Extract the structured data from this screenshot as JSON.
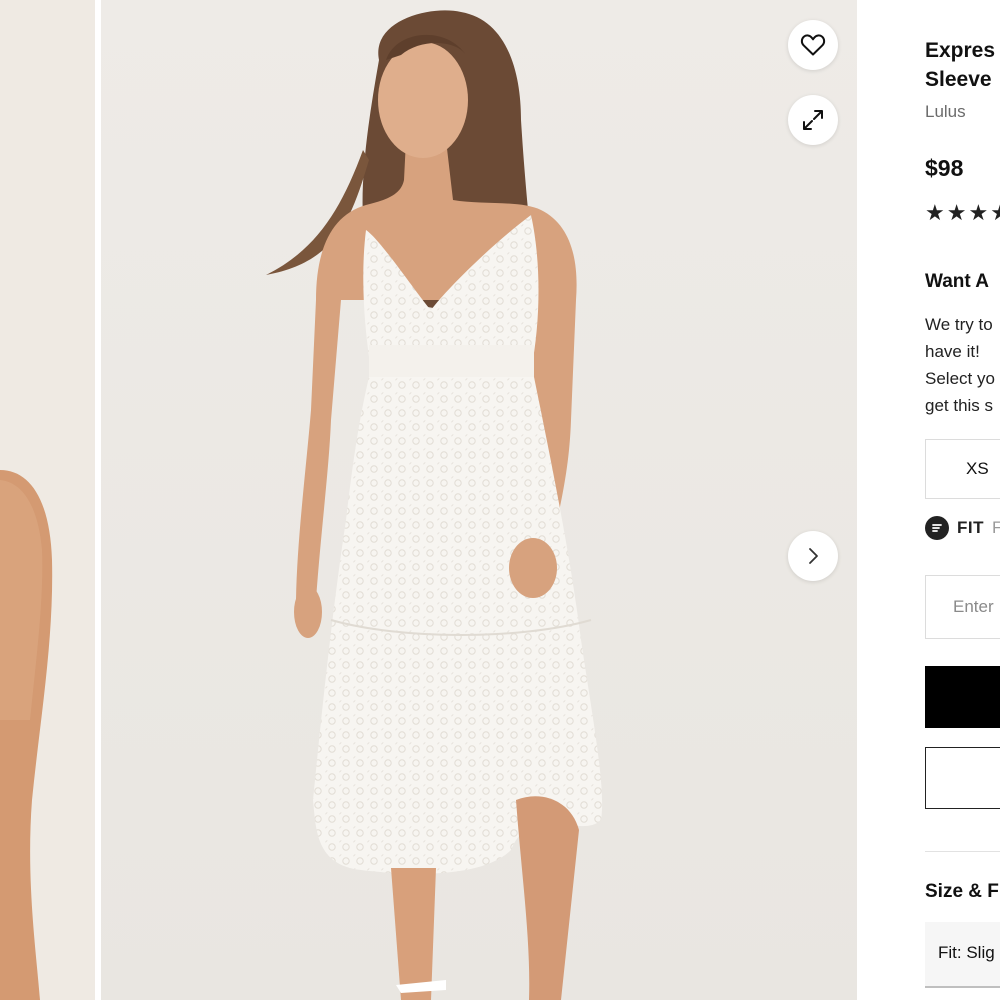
{
  "gallery": {
    "favorite_icon": "heart-outline-icon",
    "expand_icon": "expand-arrows-icon",
    "next_icon": "chevron-right-icon"
  },
  "product": {
    "title_line1": "Expres",
    "title_line2": "Sleeve",
    "brand": "Lulus",
    "price": "$98",
    "rating_stars": [
      "★",
      "★",
      "★",
      "★"
    ],
    "want_heading": "Want A",
    "want_text_lines": [
      "We try to",
      "have it!",
      "Select yo",
      "get this s"
    ],
    "size_option": "XS",
    "fit_label": "FIT",
    "fit_trailing": "F",
    "input_placeholder": "Enter",
    "size_fit_heading": "Size & F",
    "fit_note": "Fit: Slig"
  },
  "colors": {
    "primary_button": "#000000",
    "photo_background": "#efece8",
    "rating_star": "#222222"
  }
}
